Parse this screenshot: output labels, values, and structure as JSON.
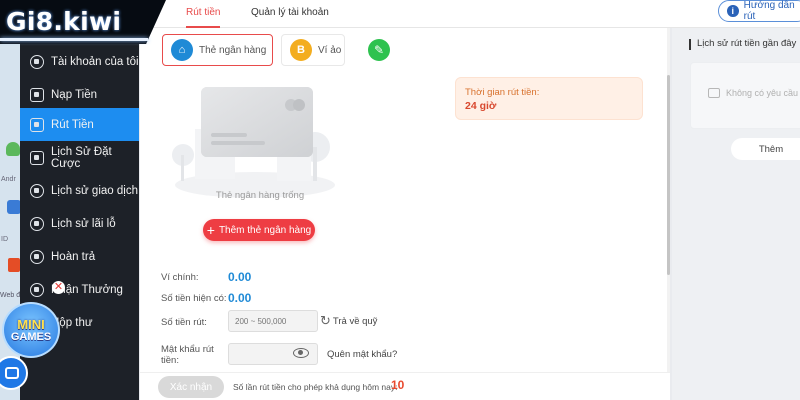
{
  "logo": {
    "text": "Gi8.kiwi"
  },
  "strip": {
    "android_text": "Andr",
    "id_text": "ID",
    "web_text": "Web đ"
  },
  "sidebar": {
    "items": [
      {
        "label": "Tài khoản của tôi",
        "icon": "account-icon",
        "active": false
      },
      {
        "label": "Nạp Tiền",
        "icon": "deposit-icon",
        "active": false
      },
      {
        "label": "Rút Tiền",
        "icon": "withdraw-icon",
        "active": true
      },
      {
        "label": "Lịch Sử Đặt Cược",
        "icon": "bet-history-icon",
        "active": false
      },
      {
        "label": "Lịch sử giao dịch",
        "icon": "transaction-history-icon",
        "active": false
      },
      {
        "label": "Lịch sử lãi lỗ",
        "icon": "profit-loss-icon",
        "active": false
      },
      {
        "label": "Hoàn trả",
        "icon": "rebate-icon",
        "active": false
      },
      {
        "label": "Nhận Thưởng",
        "icon": "reward-icon",
        "active": false
      },
      {
        "label": "Hộp thư",
        "icon": "mailbox-icon",
        "active": false
      }
    ]
  },
  "tabs": [
    {
      "label": "Rút tiền",
      "active": true
    },
    {
      "label": "Quản lý tài khoản",
      "active": false
    }
  ],
  "help": {
    "label": "Hướng dẫn rút"
  },
  "methods": [
    {
      "label": "Thẻ ngân hàng",
      "icon": "bank-card-icon",
      "active": true
    },
    {
      "label": "Ví ảo",
      "icon": "bitcoin-icon",
      "active": false
    }
  ],
  "empty_bank": {
    "label": "Thẻ ngân hàng trống",
    "add_label": "Thêm thẻ ngân hàng"
  },
  "withdraw_time": {
    "label": "Thời gian rút tiền:",
    "value": "24 giờ"
  },
  "form": {
    "main_wallet_label": "Ví chính:",
    "main_wallet_value": "0.00",
    "current_balance_label": "Số tiền hiện có:",
    "current_balance_value": "0.00",
    "amount_label": "Số tiền rút:",
    "amount_placeholder": "200 ~ 500,000",
    "refund_label": "Trả về quỹ",
    "password_label": "Mật khẩu rút tiền:",
    "forgot_label": "Quên mật khẩu?"
  },
  "footer": {
    "confirm_label": "Xác nhận",
    "limit_label": "Số lần rút tiền cho phép khả dụng hôm nay:",
    "limit_value": "10"
  },
  "right_panel": {
    "title": "Lịch sử rút tiền gần đây",
    "empty_text": "Không có yêu cầu",
    "more_label": "Thêm"
  },
  "widgets": {
    "mini_games_line1": "MINI",
    "mini_games_line2": "GAMES"
  },
  "colors": {
    "accent_red": "#ee3d43",
    "sidebar_bg": "#1d2128",
    "sidebar_active": "#1d8df0",
    "value_blue": "#1f8ad6",
    "time_orange": "#d8722e"
  }
}
